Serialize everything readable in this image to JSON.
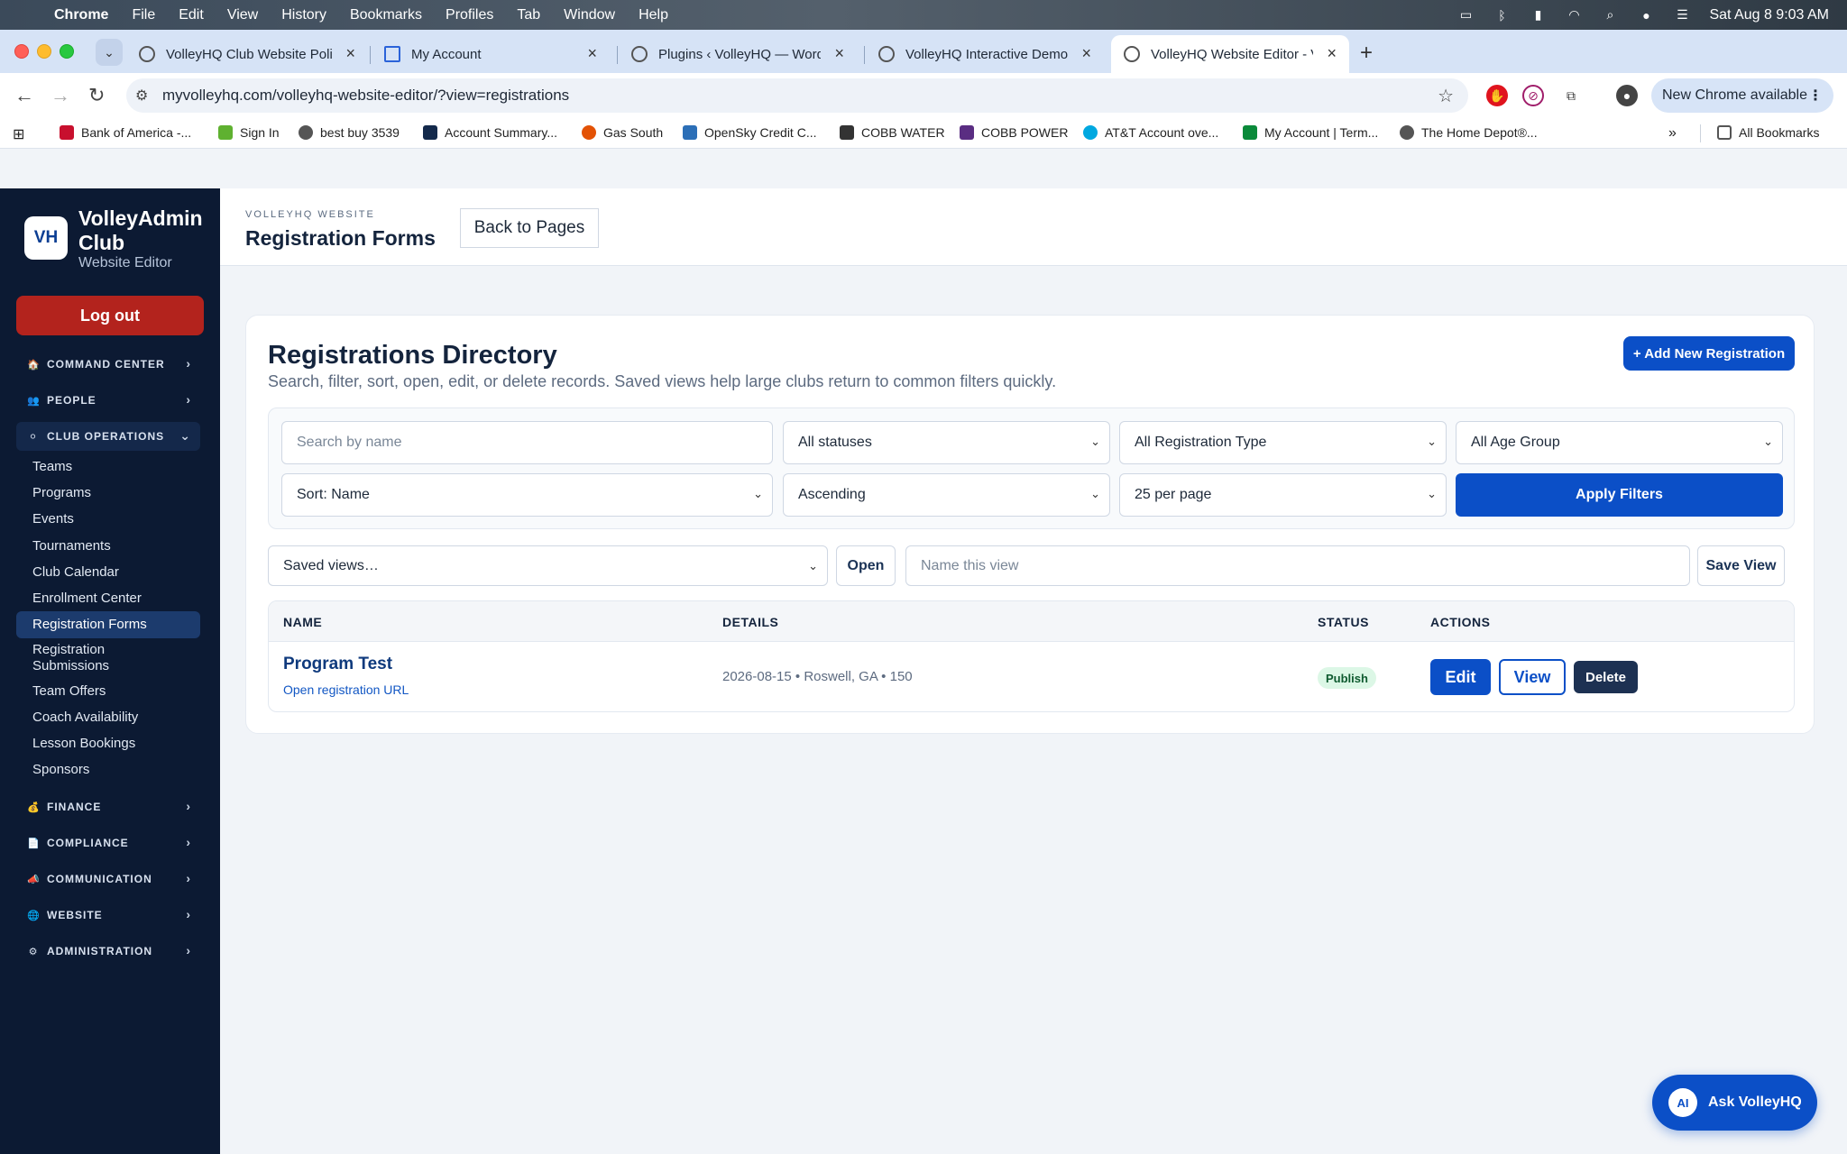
{
  "menubar": {
    "app": "Chrome",
    "items": [
      "File",
      "Edit",
      "View",
      "History",
      "Bookmarks",
      "Profiles",
      "Tab",
      "Window",
      "Help"
    ],
    "clock": "Sat Aug 8  9:03 AM",
    "icons": [
      "display-icon",
      "bluetooth-icon",
      "battery-icon",
      "wifi-icon",
      "spotlight-icon",
      "siri-icon",
      "control-center-icon"
    ]
  },
  "tabs": [
    {
      "title": "VolleyHQ Club Website Polish",
      "icon": "chatgpt-icon"
    },
    {
      "title": "My Account",
      "icon": "apps-grid-icon"
    },
    {
      "title": "Plugins ‹ VolleyHQ — WordPr",
      "icon": "globe-icon"
    },
    {
      "title": "VolleyHQ Interactive Demo - V",
      "icon": "globe-icon"
    },
    {
      "title": "VolleyHQ Website Editor - Vol",
      "icon": "globe-icon",
      "active": true
    }
  ],
  "address": {
    "url": "myvolleyhq.com/volleyhq-website-editor/?view=registrations",
    "update_label": "New Chrome available"
  },
  "bookmarks": [
    {
      "label": "Bank of America -...",
      "color": "#c8102e"
    },
    {
      "label": "Sign In",
      "color": "#5fb130"
    },
    {
      "label": "best buy 3539",
      "color": "#555555"
    },
    {
      "label": "Account Summary...",
      "color": "#13294b"
    },
    {
      "label": "Gas South",
      "color": "#e35205"
    },
    {
      "label": "OpenSky Credit C...",
      "color": "#2c6fb7"
    },
    {
      "label": "COBB WATER",
      "color": "#333333"
    },
    {
      "label": "COBB POWER",
      "color": "#5a2d82"
    },
    {
      "label": "AT&T Account ove...",
      "color": "#00a8e0"
    },
    {
      "label": "My Account | Term...",
      "color": "#0a8a3a"
    },
    {
      "label": "The Home Depot®...",
      "color": "#555555"
    }
  ],
  "bookmarks_all": "All Bookmarks",
  "sidebar": {
    "badge": "VH",
    "title": "VolleyAdmin Club",
    "subtitle": "Website Editor",
    "logout": "Log out",
    "sections_top": [
      {
        "label": "COMMAND CENTER",
        "icon": "🏠"
      },
      {
        "label": "PEOPLE",
        "icon": "👥"
      },
      {
        "label": "CLUB OPERATIONS",
        "icon": "⚪",
        "open": true
      }
    ],
    "items": [
      "Teams",
      "Programs",
      "Events",
      "Tournaments",
      "Club Calendar",
      "Enrollment Center",
      "Registration Forms",
      "Registration Submissions",
      "Team Offers",
      "Coach Availability",
      "Lesson Bookings",
      "Sponsors"
    ],
    "active_item": "Registration Forms",
    "sections_bottom": [
      {
        "label": "FINANCE",
        "icon": "💰"
      },
      {
        "label": "COMPLIANCE",
        "icon": "📄"
      },
      {
        "label": "COMMUNICATION",
        "icon": "📣"
      },
      {
        "label": "WEBSITE",
        "icon": "🌐"
      },
      {
        "label": "ADMINISTRATION",
        "icon": "⚙"
      }
    ]
  },
  "header": {
    "eyebrow": "VOLLEYHQ WEBSITE",
    "title": "Registration Forms",
    "back": "Back to Pages"
  },
  "directory": {
    "title": "Registrations Directory",
    "subtitle": "Search, filter, sort, open, edit, or delete records. Saved views help large clubs return to common filters quickly.",
    "add": "+ Add New Registration",
    "filters": {
      "search_placeholder": "Search by name",
      "status": "All statuses",
      "type": "All Registration Type",
      "age": "All Age Group",
      "sort": "Sort: Name",
      "order": "Ascending",
      "per_page": "25 per page",
      "apply": "Apply Filters"
    },
    "saved": {
      "select": "Saved views…",
      "open": "Open",
      "name_placeholder": "Name this view",
      "save": "Save View"
    },
    "columns": [
      "NAME",
      "DETAILS",
      "STATUS",
      "ACTIONS"
    ],
    "rows": [
      {
        "name": "Program Test",
        "link": "Open registration URL",
        "details": "2026-08-15 • Roswell, GA • 150",
        "status": "Publish"
      }
    ],
    "actions": {
      "edit": "Edit",
      "view": "View",
      "delete": "Delete"
    }
  },
  "assistant": {
    "badge": "AI",
    "label": "Ask VolleyHQ"
  },
  "colors": {
    "primary": "#0b4fc7",
    "sidebar": "#0c1a33",
    "danger": "#b3231d",
    "success_bg": "#dcf7e6"
  }
}
